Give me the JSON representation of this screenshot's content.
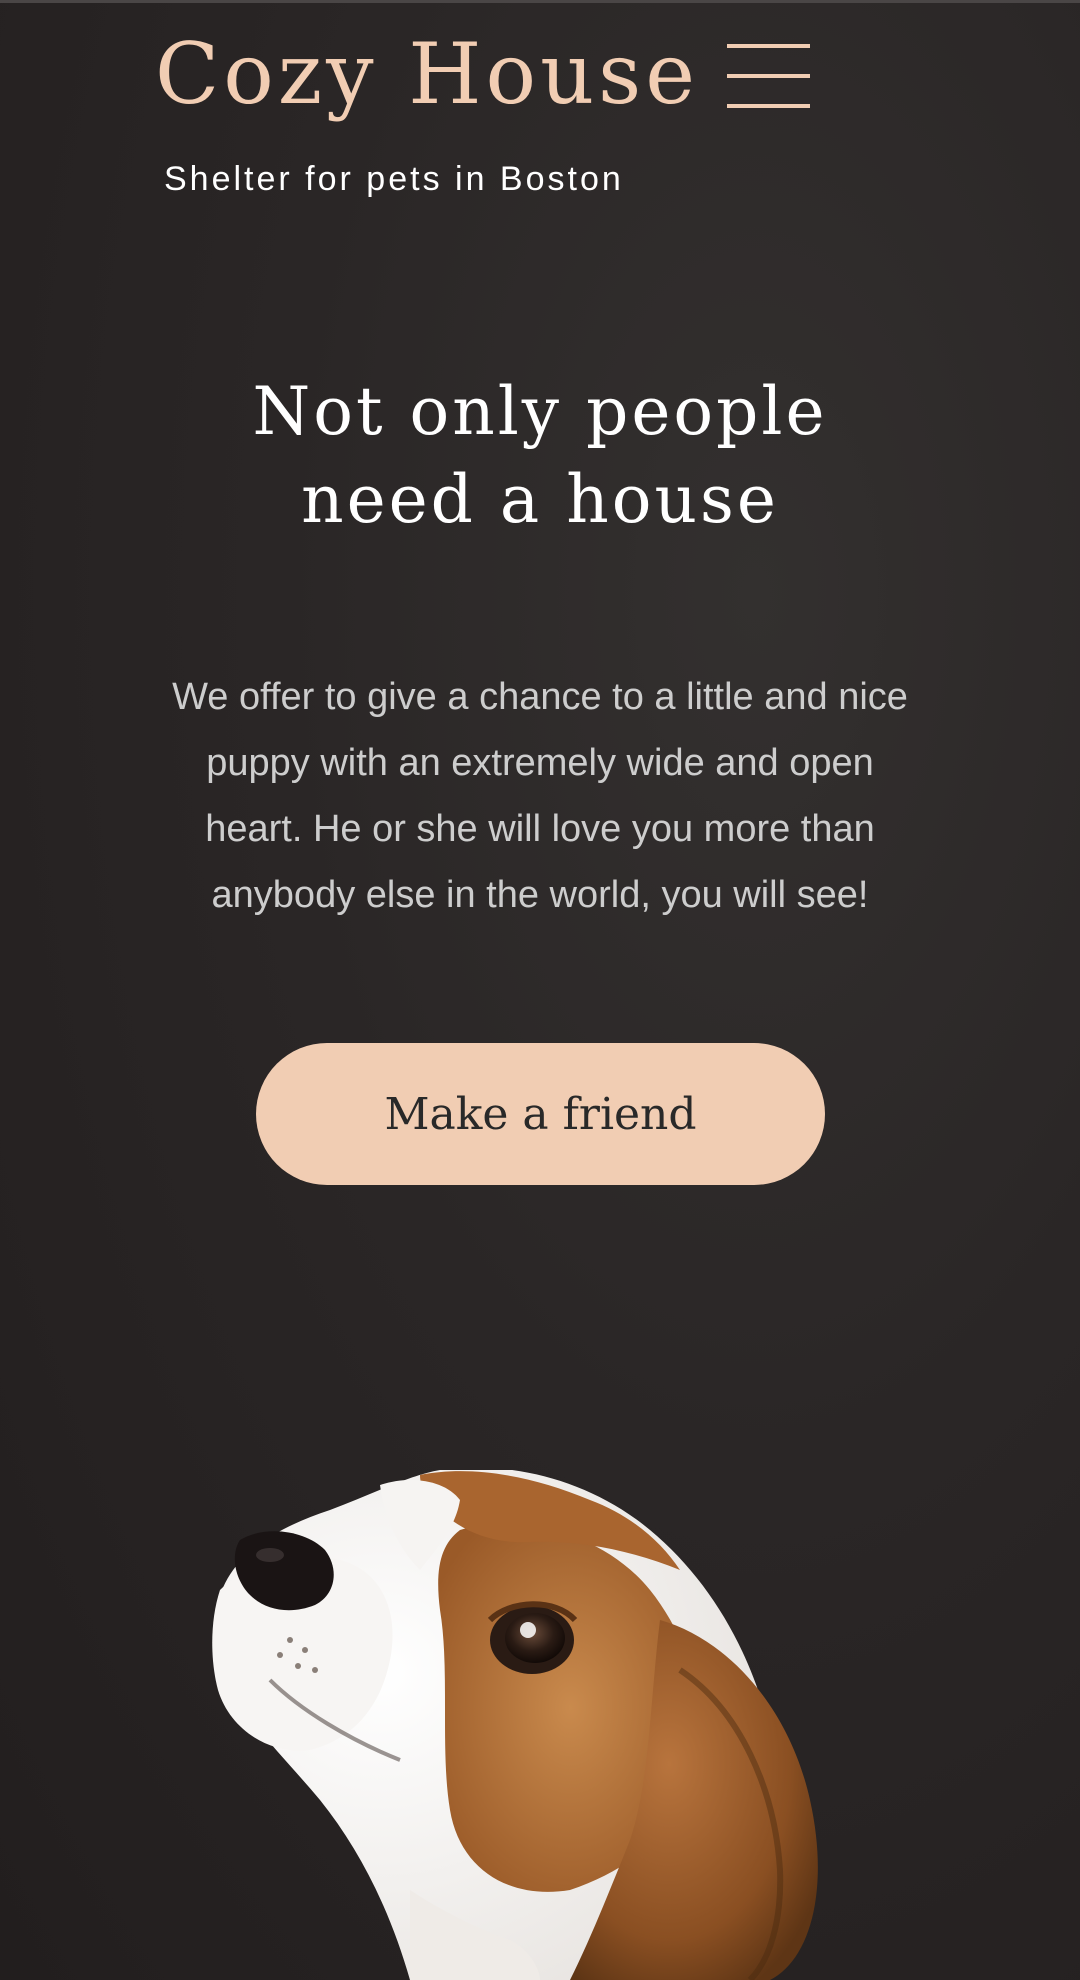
{
  "header": {
    "logo": "Cozy House",
    "tagline": "Shelter for pets in Boston",
    "menu_icon": "hamburger-menu-icon"
  },
  "hero": {
    "title_line1": "Not only people",
    "title_line2": "need a house",
    "text_lines": [
      "We offer to give a chance to a little and nice",
      "puppy with an extremely wide and open",
      "heart. He or she will love you more than",
      "anybody else in the world, you will see!"
    ],
    "cta_label": "Make a friend",
    "image": "beagle-puppy-image"
  },
  "colors": {
    "accent": "#f1cdb3",
    "background": "#292525",
    "heading": "#ffffff",
    "body_text": "#cdcdcd",
    "button_text": "#292929"
  }
}
